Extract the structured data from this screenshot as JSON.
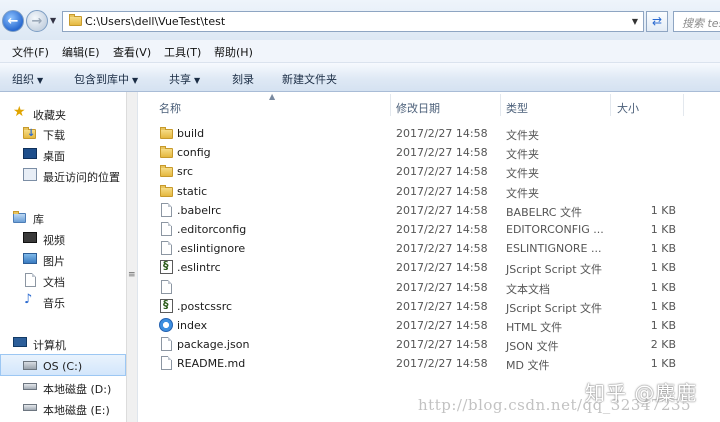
{
  "address": {
    "path": "C:\\Users\\dell\\VueTest\\test",
    "search_placeholder": "搜索 test"
  },
  "menu": [
    "文件(F)",
    "编辑(E)",
    "查看(V)",
    "工具(T)",
    "帮助(H)"
  ],
  "toolbar": {
    "organize": "组织",
    "include": "包含到库中",
    "share": "共享",
    "burn": "刻录",
    "new_folder": "新建文件夹"
  },
  "nav": {
    "favorites": "收藏夹",
    "downloads": "下载",
    "desktop": "桌面",
    "recent": "最近访问的位置",
    "libraries": "库",
    "videos": "视频",
    "pictures": "图片",
    "documents": "文档",
    "music": "音乐",
    "computer": "计算机",
    "drive_c": "OS (C:)",
    "drive_d": "本地磁盘 (D:)",
    "drive_e": "本地磁盘 (E:)"
  },
  "columns": {
    "name": "名称",
    "date": "修改日期",
    "type": "类型",
    "size": "大小"
  },
  "files": [
    {
      "name": "build",
      "date": "2017/2/27 14:58",
      "type": "文件夹",
      "size": "",
      "icon": "folder"
    },
    {
      "name": "config",
      "date": "2017/2/27 14:58",
      "type": "文件夹",
      "size": "",
      "icon": "folder"
    },
    {
      "name": "src",
      "date": "2017/2/27 14:58",
      "type": "文件夹",
      "size": "",
      "icon": "folder"
    },
    {
      "name": "static",
      "date": "2017/2/27 14:58",
      "type": "文件夹",
      "size": "",
      "icon": "folder"
    },
    {
      "name": ".babelrc",
      "date": "2017/2/27 14:58",
      "type": "BABELRC 文件",
      "size": "1 KB",
      "icon": "file"
    },
    {
      "name": ".editorconfig",
      "date": "2017/2/27 14:58",
      "type": "EDITORCONFIG ...",
      "size": "1 KB",
      "icon": "file"
    },
    {
      "name": ".eslintignore",
      "date": "2017/2/27 14:58",
      "type": "ESLINTIGNORE ...",
      "size": "1 KB",
      "icon": "file"
    },
    {
      "name": ".eslintrc",
      "date": "2017/2/27 14:58",
      "type": "JScript Script 文件",
      "size": "1 KB",
      "icon": "script"
    },
    {
      "name": "",
      "date": "2017/2/27 14:58",
      "type": "文本文档",
      "size": "1 KB",
      "icon": "file"
    },
    {
      "name": ".postcssrc",
      "date": "2017/2/27 14:58",
      "type": "JScript Script 文件",
      "size": "1 KB",
      "icon": "script"
    },
    {
      "name": "index",
      "date": "2017/2/27 14:58",
      "type": "HTML 文件",
      "size": "1 KB",
      "icon": "html"
    },
    {
      "name": "package.json",
      "date": "2017/2/27 14:58",
      "type": "JSON 文件",
      "size": "2 KB",
      "icon": "file"
    },
    {
      "name": "README.md",
      "date": "2017/2/27 14:58",
      "type": "MD 文件",
      "size": "1 KB",
      "icon": "file"
    }
  ],
  "watermark": {
    "brand": "知乎 @麋鹿",
    "url": "http://blog.csdn.net/qq_32347235"
  }
}
